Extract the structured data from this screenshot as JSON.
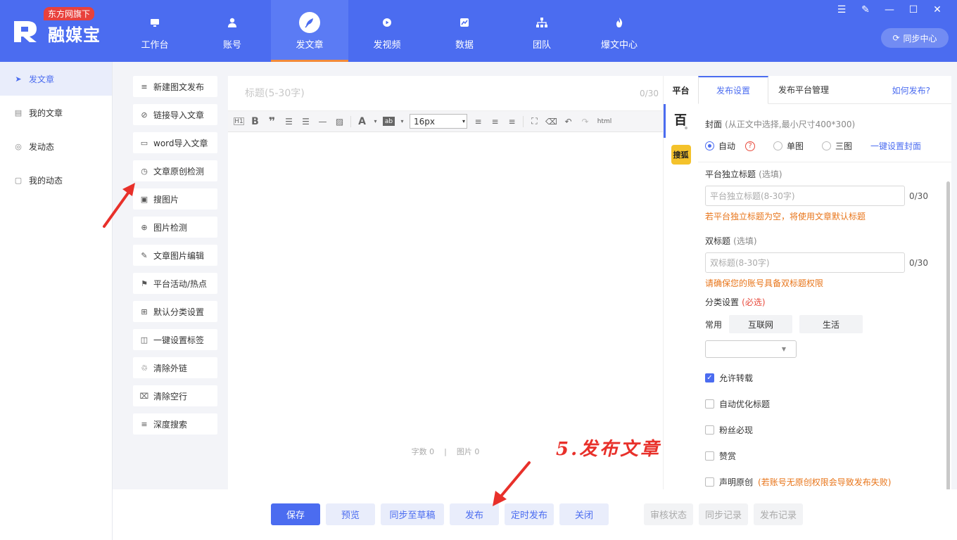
{
  "app": {
    "logo_text": "融媒宝",
    "badge": "东方网旗下"
  },
  "nav": [
    {
      "label": "工作台",
      "icon": "monitor-icon"
    },
    {
      "label": "账号",
      "icon": "user-icon"
    },
    {
      "label": "发文章",
      "icon": "feather-icon",
      "active": true
    },
    {
      "label": "发视频",
      "icon": "video-icon"
    },
    {
      "label": "数据",
      "icon": "chart-icon"
    },
    {
      "label": "团队",
      "icon": "team-icon"
    },
    {
      "label": "爆文中心",
      "icon": "flame-icon"
    }
  ],
  "window_controls": [
    "menu-icon",
    "edit-icon",
    "minimize-icon",
    "maximize-icon",
    "close-icon"
  ],
  "sync_center": "同步中心",
  "sidebar": [
    {
      "label": "发文章",
      "icon": "send-icon",
      "active": true
    },
    {
      "label": "我的文章",
      "icon": "document-icon"
    },
    {
      "label": "发动态",
      "icon": "target-icon"
    },
    {
      "label": "我的动态",
      "icon": "chat-icon"
    }
  ],
  "tools": [
    {
      "label": "新建图文发布",
      "icon": "new-post-icon"
    },
    {
      "label": "链接导入文章",
      "icon": "link-icon"
    },
    {
      "label": "word导入文章",
      "icon": "word-icon"
    },
    {
      "label": "文章原创检测",
      "icon": "check-icon"
    },
    {
      "label": "搜图片",
      "icon": "image-search-icon"
    },
    {
      "label": "图片检测",
      "icon": "zoom-icon"
    },
    {
      "label": "文章图片编辑",
      "icon": "edit-icon"
    },
    {
      "label": "平台活动/热点",
      "icon": "flag-icon"
    },
    {
      "label": "默认分类设置",
      "icon": "grid-icon"
    },
    {
      "label": "一键设置标签",
      "icon": "tag-icon"
    },
    {
      "label": "清除外链",
      "icon": "unlink-icon"
    },
    {
      "label": "清除空行",
      "icon": "trash-icon"
    },
    {
      "label": "深度搜索",
      "icon": "deep-search-icon"
    }
  ],
  "editor": {
    "title_placeholder": "标题(5-30字)",
    "title_count": "0/30",
    "font_size": "16px",
    "word_count": "字数 0",
    "image_count": "图片 0",
    "divider": "|"
  },
  "platforms": {
    "title": "平台",
    "sohu_label": "搜狐"
  },
  "settings": {
    "tabs": [
      "发布设置",
      "发布平台管理"
    ],
    "how_link": "如何发布?",
    "cover_label": "封面",
    "cover_hint": "(从正文中选择,最小尺寸400*300)",
    "cover_options": [
      "自动",
      "单图",
      "三图"
    ],
    "cover_link": "一键设置封面",
    "platform_title_label": "平台独立标题",
    "optional": "(选填)",
    "platform_title_placeholder": "平台独立标题(8-30字)",
    "platform_title_count": "0/30",
    "platform_title_warn": "若平台独立标题为空，将使用文章默认标题",
    "double_title_label": "双标题",
    "double_title_placeholder": "双标题(8-30字)",
    "double_title_count": "0/30",
    "double_title_warn": "请确保您的账号具备双标题权限",
    "category_label": "分类设置",
    "required": "(必选)",
    "common_label": "常用",
    "common_tags": [
      "互联网",
      "生活"
    ],
    "checks": [
      {
        "label": "允许转载",
        "checked": true
      },
      {
        "label": "自动优化标题",
        "checked": false
      },
      {
        "label": "粉丝必现",
        "checked": false
      },
      {
        "label": "赞赏",
        "checked": false
      },
      {
        "label": "声明原创",
        "checked": false,
        "note": "(若账号无原创权限会导致发布失败)"
      }
    ]
  },
  "bottom": {
    "save": "保存",
    "preview": "预览",
    "sync_draft": "同步至草稿",
    "publish": "发布",
    "schedule": "定时发布",
    "close": "关闭",
    "review_status": "审核状态",
    "sync_record": "同步记录",
    "publish_record": "发布记录"
  },
  "annotation": "5.发布文章",
  "colors": {
    "brand": "#4b6cf0",
    "accent_orange": "#f28a3a",
    "warning": "#e8751a",
    "annotation_red": "#e8302a"
  }
}
